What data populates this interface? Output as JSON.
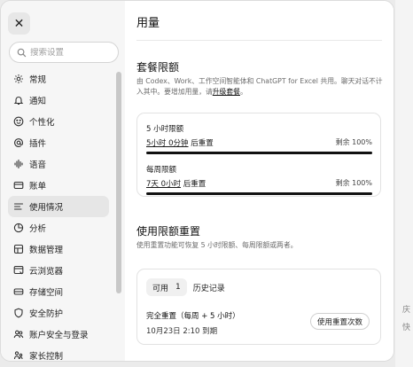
{
  "sidebar": {
    "search_placeholder": "搜索设置",
    "items": [
      {
        "label": "常规",
        "icon": "gear-icon"
      },
      {
        "label": "通知",
        "icon": "bell-icon"
      },
      {
        "label": "个性化",
        "icon": "smile-icon"
      },
      {
        "label": "插件",
        "icon": "at-icon"
      },
      {
        "label": "语音",
        "icon": "waveform-icon"
      },
      {
        "label": "账单",
        "icon": "card-icon"
      },
      {
        "label": "使用情况",
        "icon": "usage-icon",
        "active": true
      },
      {
        "label": "分析",
        "icon": "chart-icon"
      },
      {
        "label": "数据管理",
        "icon": "database-icon"
      },
      {
        "label": "云浏览器",
        "icon": "browser-icon"
      },
      {
        "label": "存储空间",
        "icon": "storage-icon"
      },
      {
        "label": "安全防护",
        "icon": "shield-icon"
      },
      {
        "label": "账户安全与登录",
        "icon": "people-icon"
      },
      {
        "label": "家长控制",
        "icon": "parental-icon"
      }
    ]
  },
  "main": {
    "title": "用量",
    "plan": {
      "title": "套餐限额",
      "desc_text": "由 Codex、Work、工作空间智能体和 ChatGPT for Excel 共用。聊天对话不计入其中。要增加用量，请",
      "desc_link": "升级套餐",
      "desc_end": "。",
      "limits": [
        {
          "name": "5 小时限额",
          "reset_value": "5小时 0分钟",
          "reset_suffix": " 后重置",
          "remaining": "剩余 100%",
          "progress": 1.0
        },
        {
          "name": "每周限额",
          "reset_value": "7天 0小时",
          "reset_suffix": " 后重置",
          "remaining": "剩余 100%",
          "progress": 1.0
        }
      ]
    },
    "reset_section": {
      "title": "使用限额重置",
      "desc": "使用重置功能可恢复 5 小时限额、每周限额或两者。",
      "tabs": [
        {
          "label": "可用",
          "count": "1"
        },
        {
          "label": "历史记录"
        }
      ],
      "item_title": "完全重置（每周 + 5 小时）",
      "item_date": "10月23日 2:10 到期",
      "button_label": "使用重置次数"
    }
  },
  "background": {
    "fragments": [
      "庆",
      "快"
    ]
  }
}
